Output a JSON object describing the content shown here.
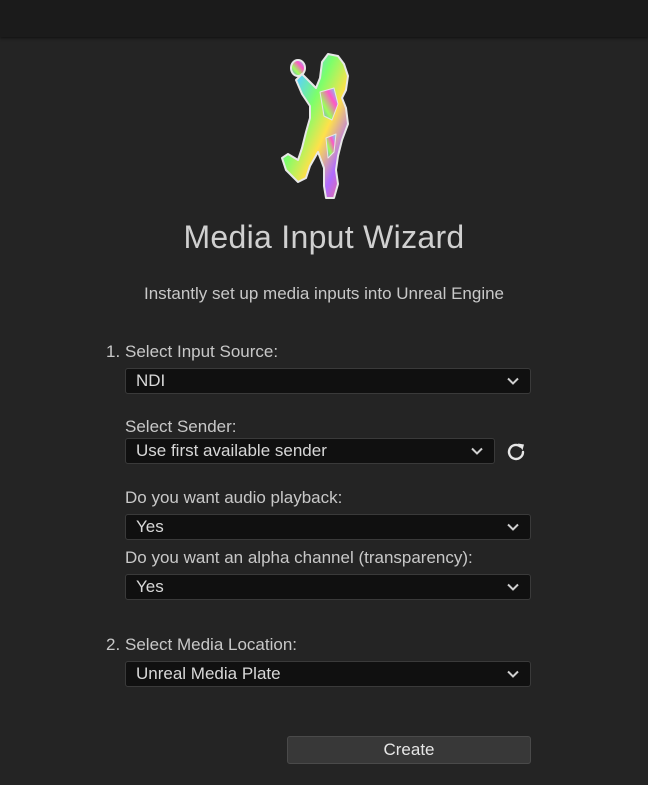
{
  "header": {
    "title": "Media Input Wizard",
    "subtitle": "Instantly set up media inputs into Unreal Engine"
  },
  "step1": {
    "number": "1.",
    "label": "Select Input Source:",
    "value": "NDI",
    "sender": {
      "label": "Select Sender:",
      "value": "Use first available sender",
      "refresh_icon": "refresh-icon"
    },
    "audio": {
      "label": "Do you want audio playback:",
      "value": "Yes"
    },
    "alpha": {
      "label": "Do you want an alpha channel (transparency):",
      "value": "Yes"
    }
  },
  "step2": {
    "number": "2.",
    "label": "Select Media Location:",
    "value": "Unreal Media Plate"
  },
  "actions": {
    "create_label": "Create"
  },
  "colors": {
    "background": "#242424",
    "titlebar": "#1b1b1b",
    "field": "#101010",
    "button": "#383838"
  }
}
